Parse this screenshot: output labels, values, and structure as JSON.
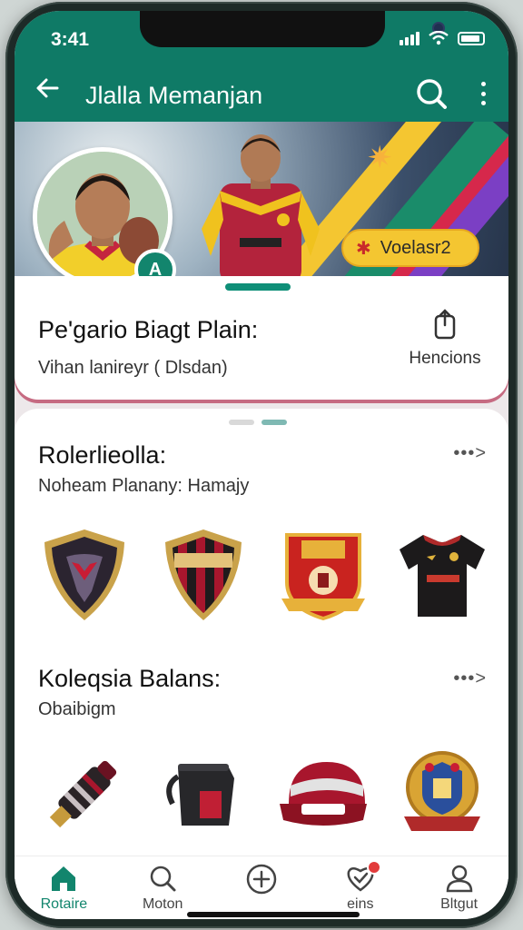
{
  "status_bar": {
    "time": "3:41"
  },
  "app_bar": {
    "title": "Jlalla Memanjan"
  },
  "banner": {
    "level_badge": "A",
    "pill_label": "Voelasr2"
  },
  "profile": {
    "name": "Pe'gario Biagt Plain:",
    "subtitle": "Vihan lanireyr ( Dlsdan)",
    "action_label": "Hencions"
  },
  "section1": {
    "title": "Rolerlieolla:",
    "subtitle": "Noheam Planany: Hamajy",
    "items": [
      "club-crest-shield-icon",
      "striped-shield-icon",
      "crest-badge-icon",
      "jersey-icon"
    ]
  },
  "section2": {
    "title": "Koleqsia Balans:",
    "subtitle": "Obaibigm",
    "items": [
      "scarf-roll-icon",
      "kettle-icon",
      "cap-icon",
      "medal-badge-icon"
    ]
  },
  "nav": [
    {
      "label": "Rotaire",
      "icon": "home-icon"
    },
    {
      "label": "Moton",
      "icon": "search-icon"
    },
    {
      "label": "",
      "icon": "plus-circle-icon"
    },
    {
      "label": "eins",
      "icon": "heart-check-icon"
    },
    {
      "label": "Bltgut",
      "icon": "profile-icon"
    }
  ],
  "colors": {
    "primary": "#0f7a66",
    "accent": "#f4c631",
    "club_red": "#b3233c"
  }
}
